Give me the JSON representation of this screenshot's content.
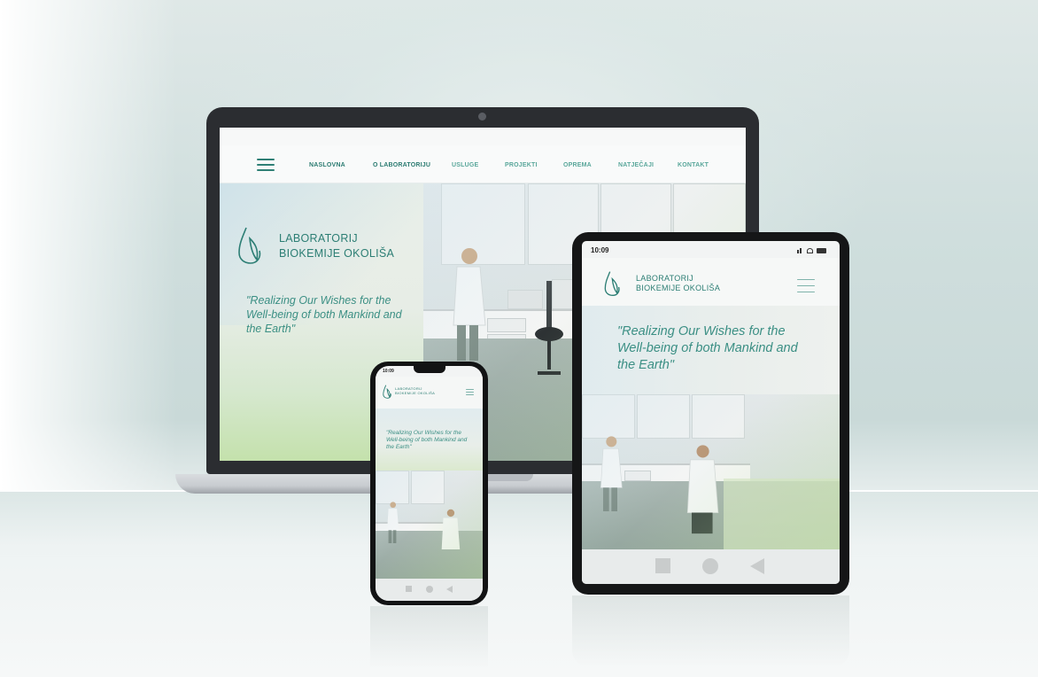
{
  "nav": {
    "items": [
      "NASLOVNA",
      "O LABORATORIJU",
      "USLUGE",
      "PROJEKTI",
      "OPREMA",
      "NATJEČAJI",
      "KONTAKT"
    ]
  },
  "brand": {
    "line1": "LABORATORIJ",
    "line2": "BIOKEMIJE OKOLIŠA"
  },
  "hero": {
    "slogan_desktop": "\"Realizing Our Wishes for the Well-being of both Mankind and the Earth\"",
    "slogan_tablet": "\"Realizing Our Wishes for the Well-being of both Mankind and the Earth\"",
    "slogan_phone": "\"Realizing Our Wishes for the Well-being of both Mankind and the Earth\""
  },
  "tablet": {
    "status_time": "10:09"
  },
  "phone": {
    "status_time": "10:09"
  },
  "icons": {
    "menu": "hamburger-icon",
    "logo": "leaf-flask-logo",
    "nav_square": "square-icon",
    "nav_circle": "circle-icon",
    "nav_back": "triangle-back-icon"
  },
  "colors": {
    "brand_teal": "#2c7e74",
    "accent_green": "#c4e1ac",
    "device_dark": "#151617"
  }
}
